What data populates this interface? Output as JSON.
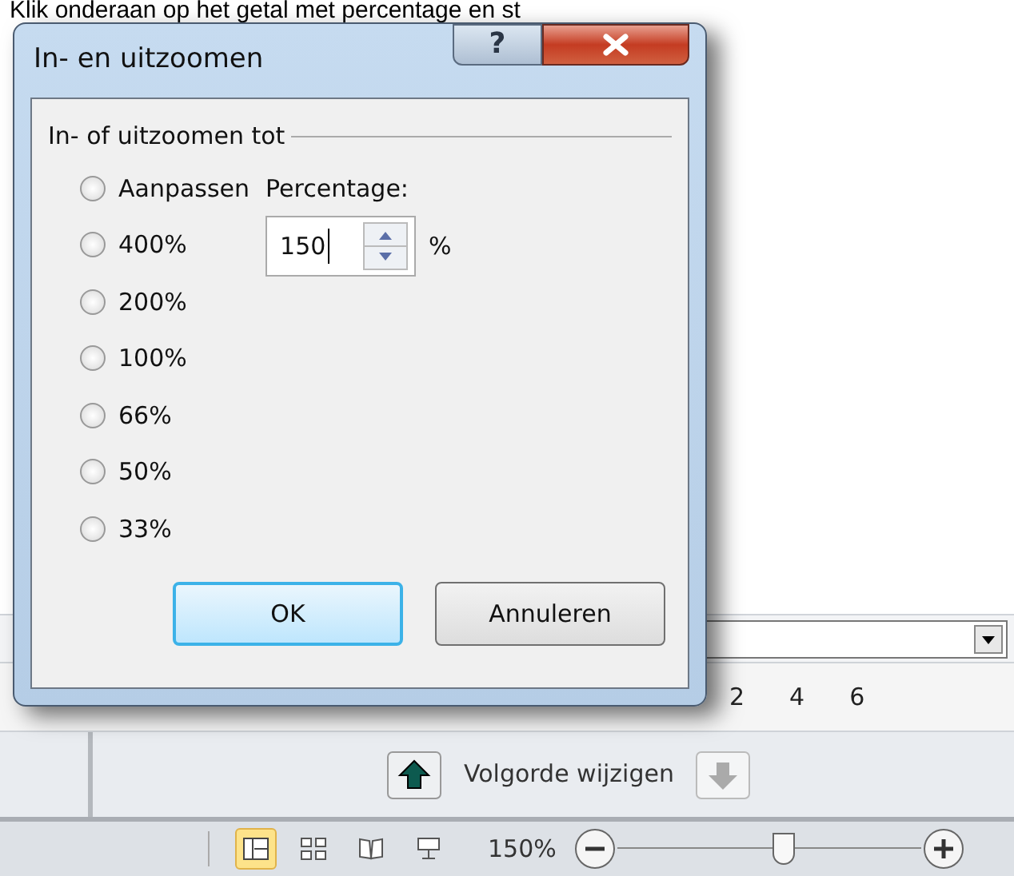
{
  "instruction": "Klik onderaan op het getal met percentage en st",
  "dialog": {
    "title": "In- en uitzoomen",
    "help_button": "?",
    "group_label": "In- of uitzoomen tot",
    "options": [
      {
        "label": "Aanpassen",
        "selected": false
      },
      {
        "label": "400%",
        "selected": false
      },
      {
        "label": "200%",
        "selected": false
      },
      {
        "label": "100%",
        "selected": false
      },
      {
        "label": "66%",
        "selected": false
      },
      {
        "label": "50%",
        "selected": false
      },
      {
        "label": "33%",
        "selected": false
      }
    ],
    "percentage_label": "Percentage:",
    "percentage_value": "150",
    "percent_sign": "%",
    "buttons": [
      {
        "label": "OK",
        "default": true
      },
      {
        "label": "Annuleren",
        "default": false
      }
    ]
  },
  "ruler": {
    "labels": [
      "2",
      "4",
      "6"
    ]
  },
  "reorder_label": "Volgorde wijzigen",
  "status_bar": {
    "zoom": "150%",
    "zoom_slider": {
      "level": 0.55
    },
    "views": [
      {
        "kind": "normal",
        "selected": true
      },
      {
        "kind": "sorter",
        "selected": false
      },
      {
        "kind": "reading",
        "selected": false
      },
      {
        "kind": "slideshow",
        "selected": false
      }
    ]
  }
}
